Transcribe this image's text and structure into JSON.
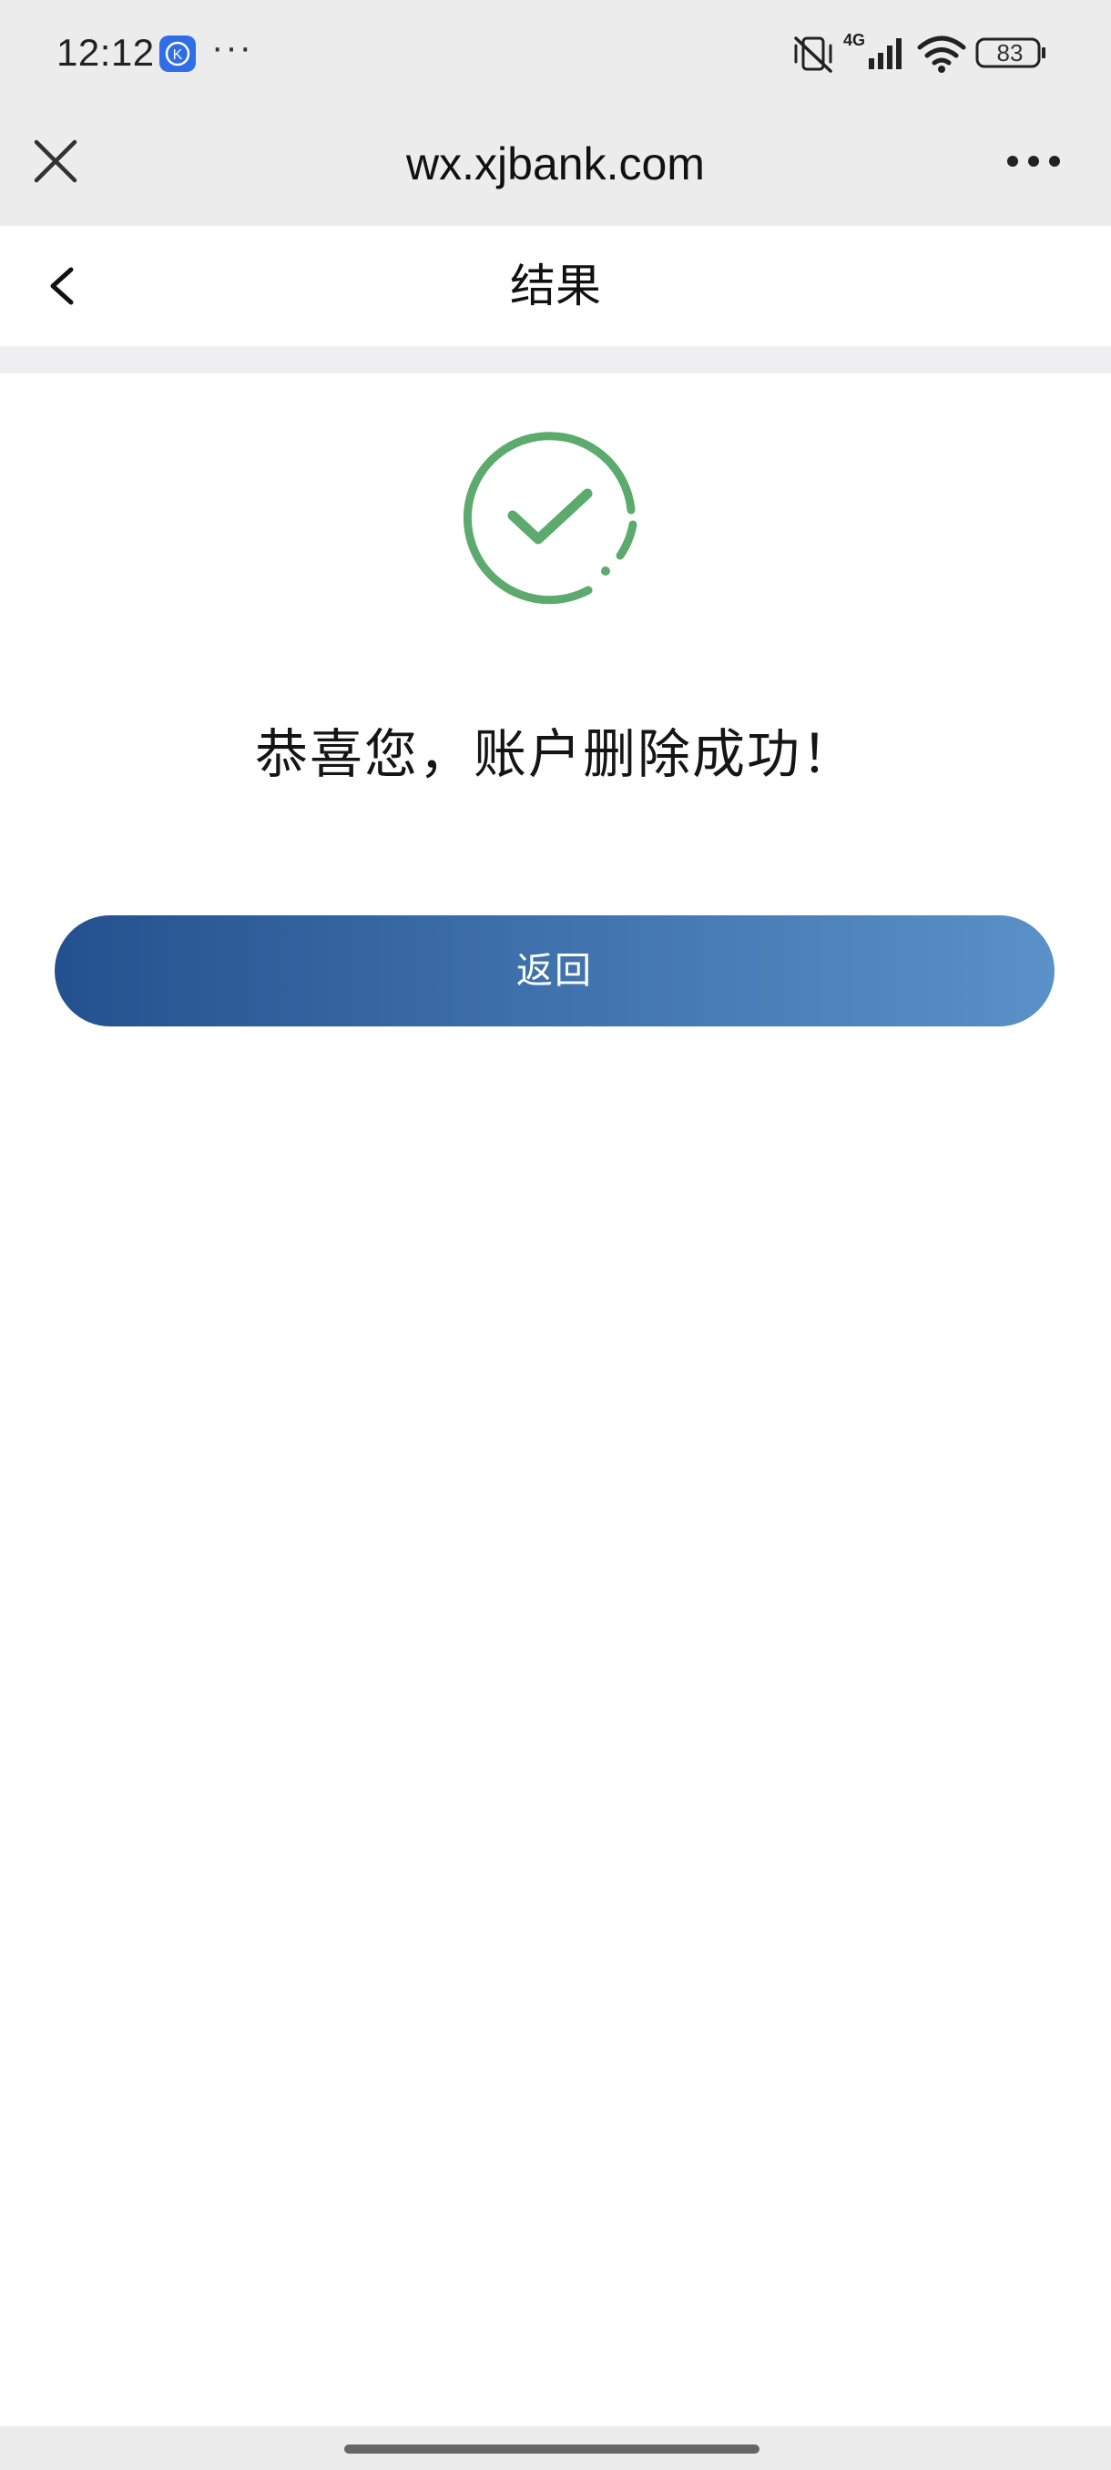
{
  "status_bar": {
    "time": "12:12",
    "app_badge_letter": "K",
    "more_notifications": "···",
    "network": "4G",
    "battery": "83"
  },
  "browser": {
    "url": "wx.xjbank.com",
    "close_icon": "close-icon",
    "more_icon": "more-icon"
  },
  "page": {
    "title": "结果",
    "back_icon": "chevron-left-icon"
  },
  "result": {
    "icon": "success-check-icon",
    "icon_color": "#5caa6e",
    "message": "恭喜您，账户删除成功！",
    "return_label": "返回"
  },
  "colors": {
    "button_gradient_start": "#23518f",
    "button_gradient_end": "#5a91c8",
    "header_bg": "#ececec",
    "separator_bg": "#efeff3"
  }
}
